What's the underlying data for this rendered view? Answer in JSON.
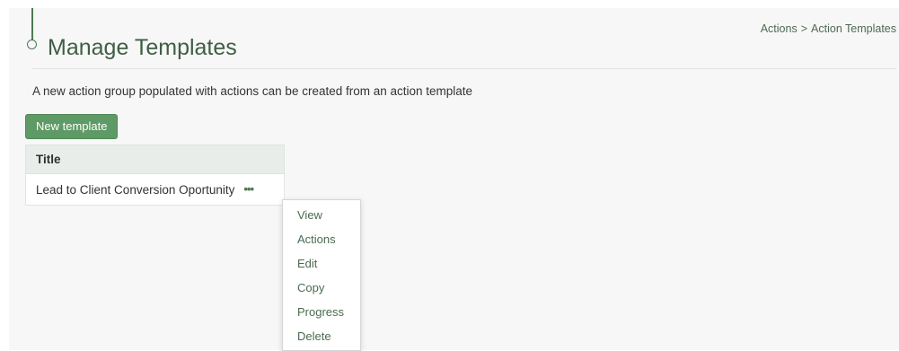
{
  "page": {
    "title": "Manage Templates",
    "description": "A new action group populated with actions can be created from an action template"
  },
  "breadcrumb": {
    "items": [
      "Actions",
      "Action Templates"
    ],
    "separator": ">"
  },
  "toolbar": {
    "new_template_label": "New template"
  },
  "table": {
    "columns": [
      "Title"
    ],
    "rows": [
      {
        "title": "Lead to Client Conversion Oportunity",
        "menu_trigger": "•••"
      }
    ]
  },
  "context_menu": {
    "items": [
      "View",
      "Actions",
      "Edit",
      "Copy",
      "Progress",
      "Delete"
    ]
  },
  "colors": {
    "accent": "#5e9a65",
    "title_text": "#3f5e44",
    "link_text": "#4a6b4f",
    "panel_bg": "#f7f7f7"
  },
  "icons": {
    "title_marker": "circle-node-icon",
    "row_menu": "more-horizontal-icon"
  }
}
